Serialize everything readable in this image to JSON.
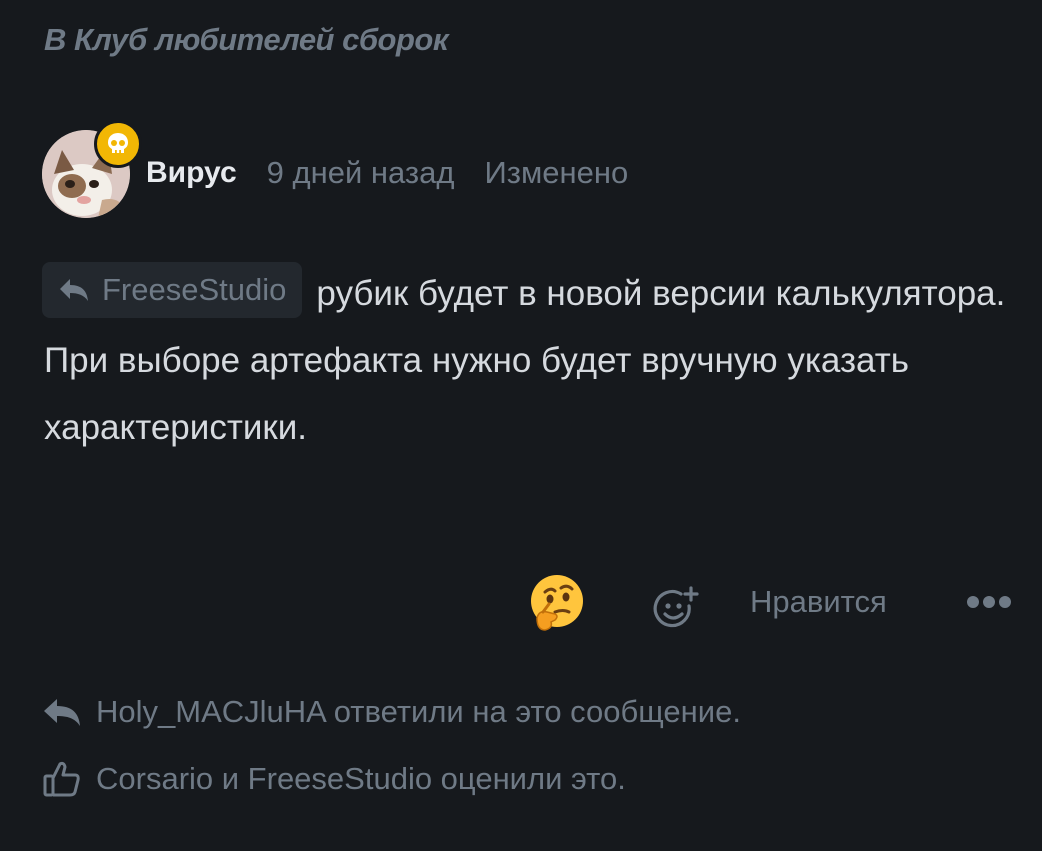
{
  "club": {
    "link_text": "В Клуб любителей сборок"
  },
  "post": {
    "author": "Вирус",
    "time": "9 дней назад",
    "edited": "Изменено",
    "avatar_badge_icon": "skull-icon",
    "reply_to": "FreeseStudio",
    "text_line1": "рубик будет в новой версии калькулятора.",
    "text_line2": "При выборе артефакта нужно будет вручную указать характеристики."
  },
  "actions": {
    "reaction_emoji": "thinking-face-emoji",
    "add_reaction_icon": "add-emoji-icon",
    "like_label": "Нравится",
    "more_icon": "ellipsis-icon"
  },
  "footer": {
    "replied_text": "Holy_MACJluHA ответили на это сообщение.",
    "liked_text": "Corsario и FreeseStudio оценили это."
  },
  "colors": {
    "background": "#16191d",
    "muted": "#6f7a86",
    "text": "#d6dadf",
    "badge": "#f2b705"
  }
}
